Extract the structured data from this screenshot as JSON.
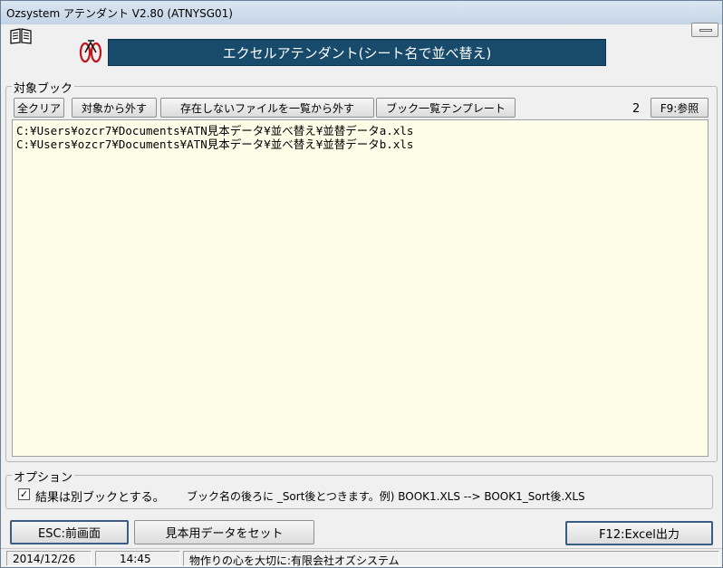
{
  "window": {
    "title": "Ozsystem アテンダント V2.80 (ATNYSG01)"
  },
  "icons": {
    "book": "book-icon",
    "bicycle": "bicycle-icon",
    "minimize": "minimize-icon"
  },
  "header": {
    "banner_text": "エクセルアテンダント(シート名で並べ替え)",
    "banner_color": "#174a6b"
  },
  "books_group": {
    "legend": "対象ブック",
    "buttons": {
      "clear_all": "全クリア",
      "remove": "対象から外す",
      "remove_missing": "存在しないファイルを一覧から外す",
      "template": "ブック一覧テンプレート",
      "browse": "F9:参照"
    },
    "count": "2",
    "files": [
      "C:¥Users¥ozcr7¥Documents¥ATN見本データ¥並べ替え¥並替データa.xls",
      "C:¥Users¥ozcr7¥Documents¥ATN見本データ¥並べ替え¥並替データb.xls"
    ],
    "list_bg": "#fefde8"
  },
  "options_group": {
    "legend": "オプション",
    "separate_book_checked": true,
    "check_mark": "✓",
    "separate_book_label": "結果は別ブックとする。",
    "note": "ブック名の後ろに _Sort後とつきます。例) BOOK1.XLS --> BOOK1_Sort後.XLS"
  },
  "footer_buttons": {
    "back": "ESC:前画面",
    "sample": "見本用データをセット",
    "excel_output": "F12:Excel出力"
  },
  "status": {
    "date": "2014/12/26",
    "time": "14:45",
    "message": "物作りの心を大切に:有限会社オズシステム"
  }
}
